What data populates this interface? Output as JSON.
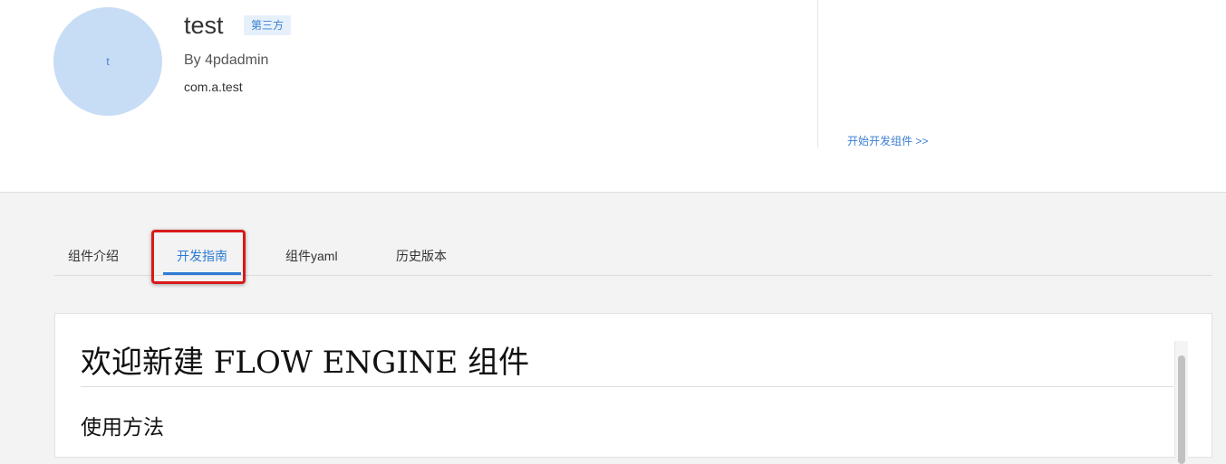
{
  "header": {
    "avatar_letter": "t",
    "title": "test",
    "badge": "第三方",
    "author": "By 4pdadmin",
    "package": "com.a.test",
    "start_link": "开始开发组件 >>"
  },
  "tabs": [
    {
      "label": "组件介绍",
      "active": false
    },
    {
      "label": "开发指南",
      "active": true
    },
    {
      "label": "组件yaml",
      "active": false
    },
    {
      "label": "历史版本",
      "active": false
    }
  ],
  "doc": {
    "h1": "欢迎新建 FLOW ENGINE 组件",
    "h2": "使用方法"
  },
  "colors": {
    "accent": "#2d7bd6",
    "highlight": "#d71a1a",
    "avatar_bg": "#c7ddf5"
  }
}
